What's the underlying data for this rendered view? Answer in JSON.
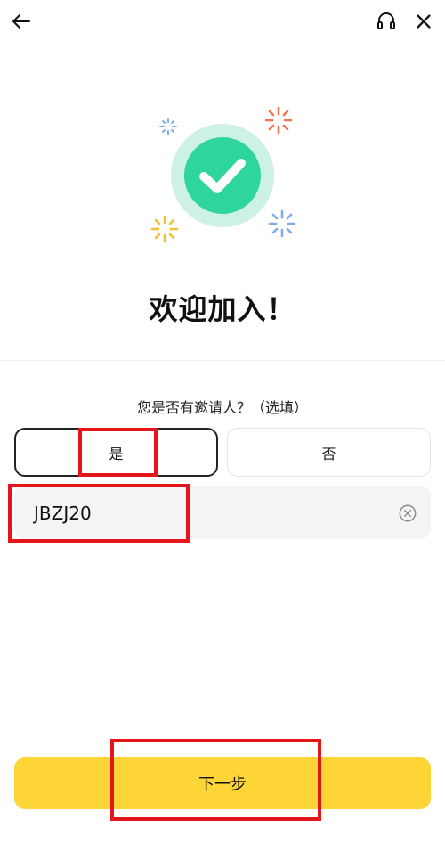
{
  "header": {
    "back_icon": "arrow-left-icon",
    "support_icon": "headset-icon",
    "close_icon": "close-icon"
  },
  "hero": {
    "icon": "check-circle-icon",
    "colors": {
      "ring": "#cdf1e2",
      "circle": "#2fd69b",
      "spark_red": "#f0734f",
      "spark_blue": "#80aaf0",
      "spark_yellow": "#f5c031"
    }
  },
  "welcome": {
    "title": "欢迎加入！"
  },
  "inviter": {
    "question": "您是否有邀请人？（选填）",
    "yes_label": "是",
    "no_label": "否",
    "code_value": "JBZJ20",
    "clear_icon": "clear-circle-icon"
  },
  "footer": {
    "next_label": "下一步"
  },
  "colors": {
    "accent": "#fdd537",
    "highlight": "#e4161b"
  }
}
